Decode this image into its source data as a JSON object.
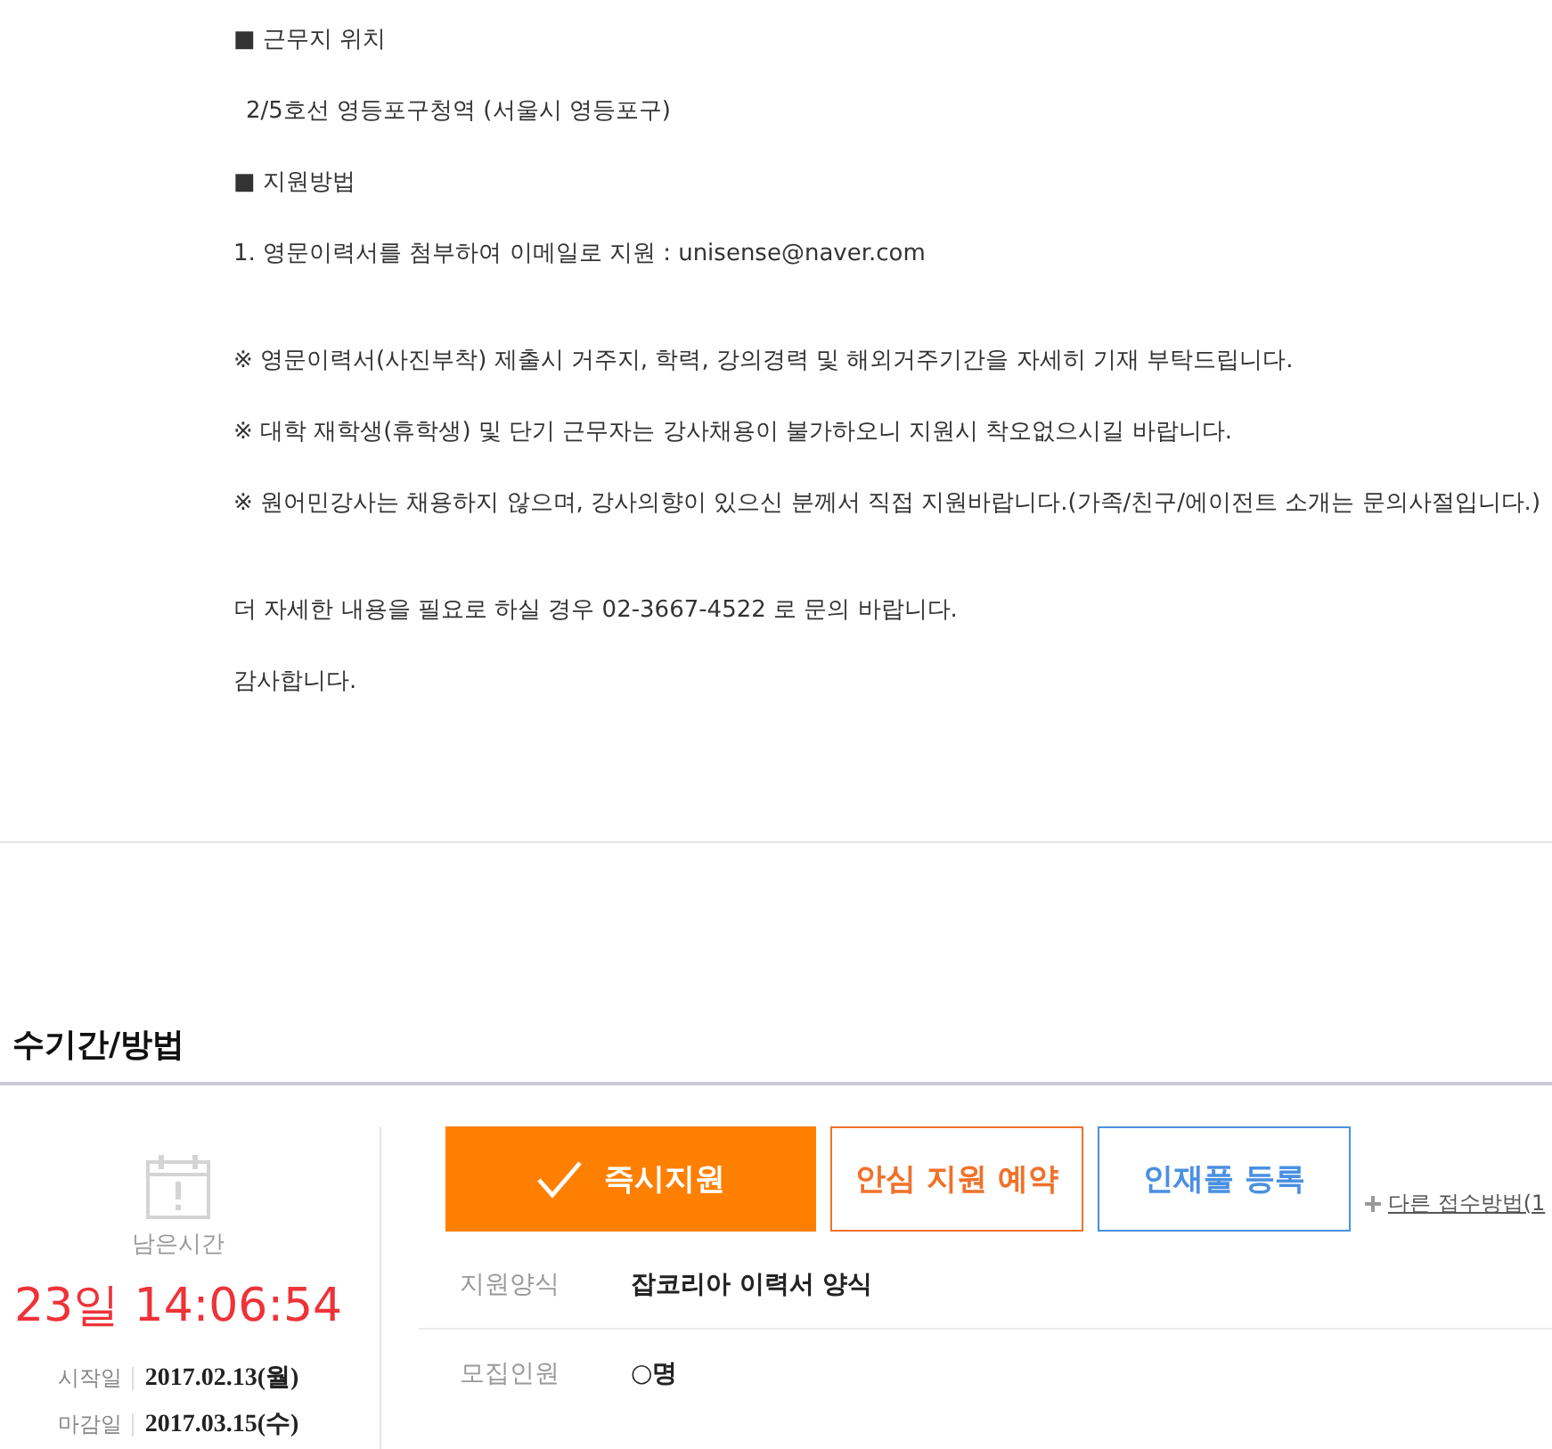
{
  "article": {
    "blocks": [
      {
        "lines": [
          {
            "kind": "heading",
            "text": "■ 근무지 위치"
          },
          {
            "kind": "sub",
            "text": "2/5호선 영등포구청역 (서울시 영등포구)"
          },
          {
            "kind": "heading",
            "text": "■ 지원방법"
          },
          {
            "kind": "text",
            "text": "1. 영문이력서를 첨부하여 이메일로 지원 : unisense@naver.com"
          }
        ]
      },
      {
        "lines": [
          {
            "kind": "text",
            "text": "※ 영문이력서(사진부착) 제출시 거주지, 학력, 강의경력 및 해외거주기간을 자세히 기재 부탁드립니다."
          },
          {
            "kind": "text",
            "text": "※ 대학 재학생(휴학생) 및 단기 근무자는 강사채용이 불가하오니 지원시 착오없으시길 바랍니다."
          },
          {
            "kind": "text",
            "text": "※ 원어민강사는 채용하지 않으며, 강사의향이 있으신 분께서 직접 지원바랍니다.(가족/친구/에이전트 소개는 문의사절입니다.)"
          }
        ]
      },
      {
        "lines": [
          {
            "kind": "text",
            "text": "더 자세한 내용을 필요로 하실 경우 02-3667-4522 로 문의 바랍니다."
          },
          {
            "kind": "text",
            "text": "감사합니다."
          }
        ]
      }
    ]
  },
  "application": {
    "title": "수기간/방법",
    "remaining_label": "남은시간",
    "remaining_time": "23일 14:06:54",
    "dates": [
      {
        "label": "시작일",
        "value": "2017.02.13(월)"
      },
      {
        "label": "마감일",
        "value": "2017.03.15(수)"
      }
    ],
    "buttons": [
      {
        "kind": "filled",
        "label": "즉시지원",
        "color": "#ff7f00"
      },
      {
        "kind": "outline",
        "label": "안심 지원 예약",
        "color": "#f0712a"
      },
      {
        "kind": "outline",
        "label": "인재풀 등록",
        "color": "#4a90e2"
      }
    ],
    "other_link": "다른 접수방법(1",
    "details": [
      {
        "label": "지원양식",
        "value": "잡코리아 이력서 양식"
      },
      {
        "label": "모집인원",
        "value": "○명"
      }
    ]
  }
}
